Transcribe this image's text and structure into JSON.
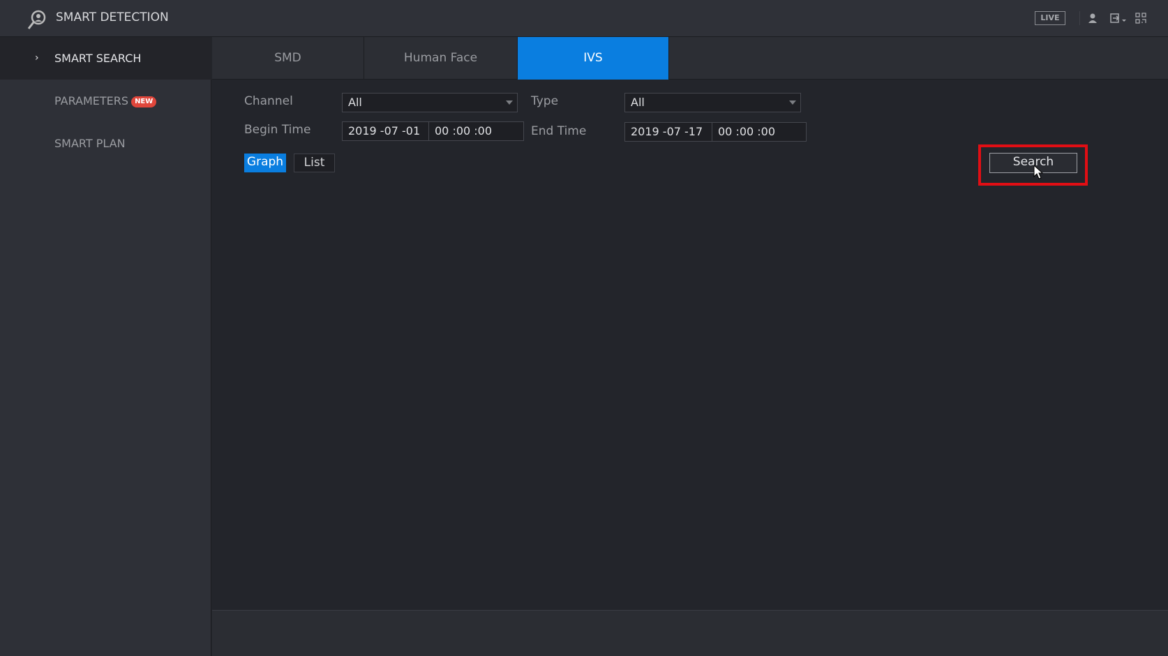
{
  "header": {
    "title": "SMART DETECTION",
    "live_label": "LIVE"
  },
  "sidebar": {
    "items": [
      {
        "label": "SMART SEARCH"
      },
      {
        "label": "PARAMETERS",
        "badge": "NEW"
      },
      {
        "label": "SMART PLAN"
      }
    ]
  },
  "tabs": [
    {
      "label": "SMD"
    },
    {
      "label": "Human Face"
    },
    {
      "label": "IVS"
    }
  ],
  "form": {
    "channel_label": "Channel",
    "channel_value": "All",
    "type_label": "Type",
    "type_value": "All",
    "begin_label": "Begin Time",
    "begin_date": "2019 -07 -01",
    "begin_time": "00 :00 :00",
    "end_label": "End Time",
    "end_date": "2019 -07 -17",
    "end_time": "00 :00 :00"
  },
  "view": {
    "graph": "Graph",
    "list": "List"
  },
  "search_label": "Search",
  "colors": {
    "accent": "#0a7ee0",
    "highlight": "#e10e14",
    "badge": "#e0463b"
  }
}
